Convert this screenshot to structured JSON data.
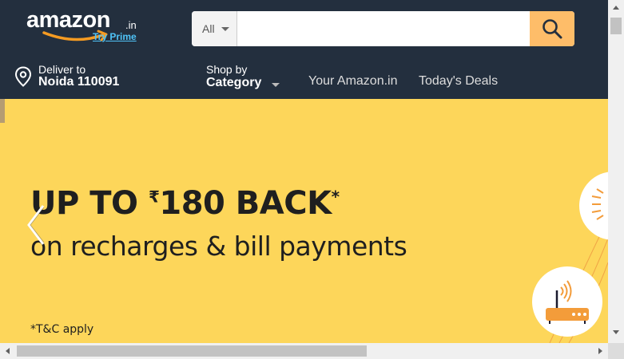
{
  "header": {
    "logo_text": "amazon",
    "logo_suffix": ".in",
    "try_prime": "Try Prime"
  },
  "search": {
    "category": "All",
    "placeholder": "",
    "value": ""
  },
  "deliver": {
    "line1": "Deliver to",
    "line2": "Noida 110091"
  },
  "nav": {
    "shop_by_line1": "Shop by",
    "shop_by_line2": "Category",
    "your_amazon": "Your Amazon.in",
    "todays_deals": "Today's Deals"
  },
  "banner": {
    "headline_prefix": "UP TO ",
    "rupee_sign": "₹",
    "headline_amount": "180 BACK",
    "headline_star": "*",
    "subline": "on recharges & bill payments",
    "tnc": "*T&C apply"
  },
  "colors": {
    "header_bg": "#232f3e",
    "search_button": "#febd69",
    "banner_bg": "#fdd65a",
    "logo_smile": "#f59b22",
    "prime_link": "#4fc3f7"
  },
  "icons": {
    "search": "search-icon",
    "location": "location-pin-icon",
    "prev": "chevron-left-icon",
    "router": "router-icon",
    "bulb": "bulb-icon"
  }
}
